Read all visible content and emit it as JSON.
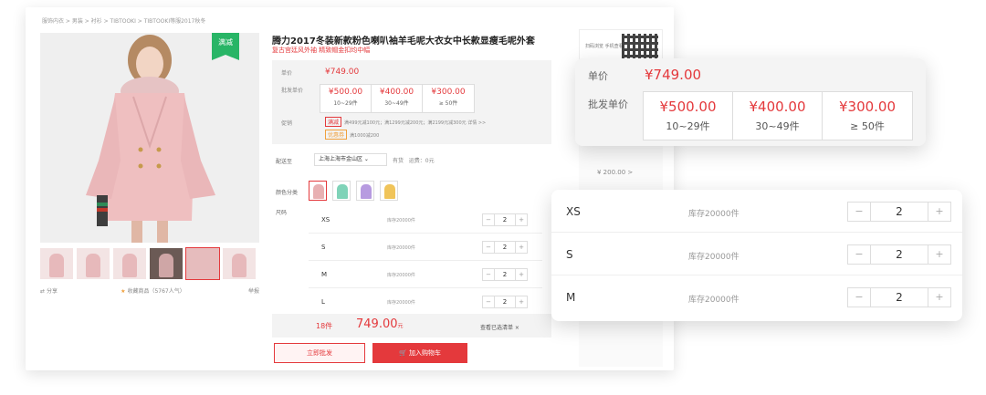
{
  "breadcrumb": "服饰内衣 > 男装 > 衬衫 > TIBTOOKI > TIBTOOKI等服2017秋冬",
  "product": {
    "promo_tag": "满减",
    "title": "腾力2017冬装新款粉色喇叭袖羊毛呢大衣女中长款显瘦毛呢外套",
    "subtitle": "复古宫廷风外袖 精致帽金扣均中幅"
  },
  "qr": {
    "text": "扫码浏览 手机查看"
  },
  "side_strip": {
    "price": "¥ 200.00 >"
  },
  "share": {
    "share_label": "分享",
    "fav_label": "收藏商品（5767人气）",
    "report_label": "举报"
  },
  "pricing": {
    "unit_label": "单价",
    "unit_price": "¥749.00",
    "batch_label": "批发单价",
    "tiers": [
      {
        "price": "¥500.00",
        "range": "10~29件"
      },
      {
        "price": "¥400.00",
        "range": "30~49件"
      },
      {
        "price": "¥300.00",
        "range": "≥ 50件"
      }
    ],
    "promo_label": "促销",
    "promo_badge": "满减",
    "promo_text": "满499元减100元；满1299元减200元；满2199元减300元 详情 >>",
    "promo_badge2": "优惠券",
    "promo_text2": "满1000减200"
  },
  "shipping": {
    "label": "配送至",
    "location": "上海上海市金山区 ⌄",
    "stock": "有货",
    "freight": "运费：0元"
  },
  "colors": {
    "label": "颜色分类",
    "items": [
      {
        "color": "#e8b0b2"
      },
      {
        "color": "#7fd3b8"
      },
      {
        "color": "#b79be0"
      },
      {
        "color": "#f0c45a"
      }
    ]
  },
  "sizes": {
    "label": "尺码",
    "rows": [
      {
        "size": "XS",
        "stock": "库存20000件",
        "qty": "2"
      },
      {
        "size": "S",
        "stock": "库存20000件",
        "qty": "2"
      },
      {
        "size": "M",
        "stock": "库存20000件",
        "qty": "2"
      },
      {
        "size": "L",
        "stock": "库存20000件",
        "qty": "2"
      }
    ]
  },
  "summary": {
    "count": "18件",
    "total": "749.00",
    "currency_unit": "元",
    "view_list": "查看已选清单 ×"
  },
  "actions": {
    "buy_now": "立即批发",
    "add_to_cart": "加入购物车"
  },
  "zoom_price": {
    "unit_label": "单价",
    "unit_price": "¥749.00",
    "batch_label": "批发单价",
    "tiers": [
      {
        "price": "¥500.00",
        "range": "10~29件"
      },
      {
        "price": "¥400.00",
        "range": "30~49件"
      },
      {
        "price": "¥300.00",
        "range": "≥ 50件"
      }
    ]
  },
  "zoom_sizes": {
    "rows": [
      {
        "size": "XS",
        "stock": "库存20000件",
        "qty": "2"
      },
      {
        "size": "S",
        "stock": "库存20000件",
        "qty": "2"
      },
      {
        "size": "M",
        "stock": "库存20000件",
        "qty": "2"
      }
    ]
  },
  "qty_controls": {
    "minus": "−",
    "plus": "+"
  }
}
